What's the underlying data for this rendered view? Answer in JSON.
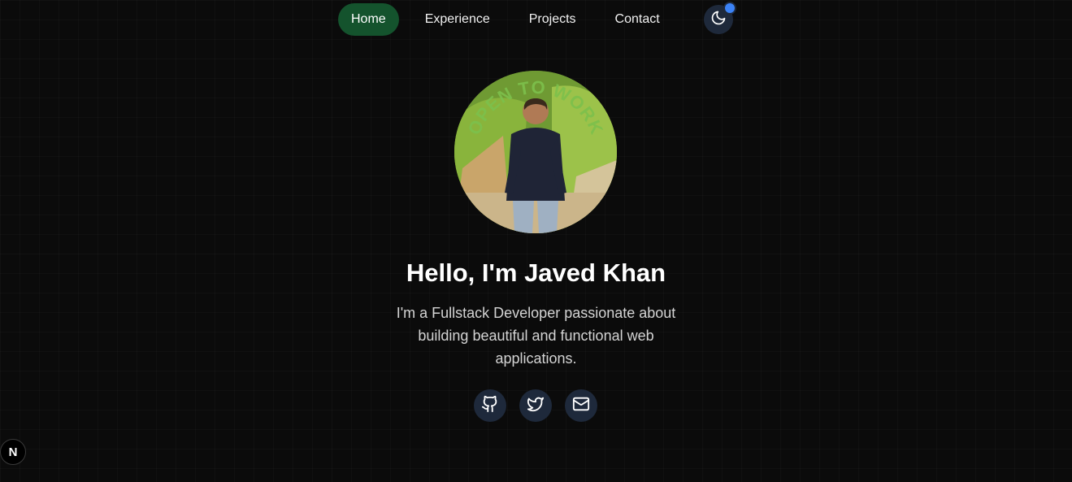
{
  "nav": {
    "items": [
      {
        "label": "Home",
        "active": true
      },
      {
        "label": "Experience",
        "active": false
      },
      {
        "label": "Projects",
        "active": false
      },
      {
        "label": "Contact",
        "active": false
      }
    ],
    "theme_icon": "moon-icon",
    "active_color": "#14532d"
  },
  "hero": {
    "avatar_badge_text": "OPEN TO WORK",
    "title": "Hello, I'm Javed Khan",
    "subtitle": "I'm a Fullstack Developer passionate about building beautiful and functional web applications."
  },
  "socials": [
    {
      "icon": "github-icon"
    },
    {
      "icon": "twitter-icon"
    },
    {
      "icon": "mail-icon"
    }
  ],
  "dev_badge": {
    "label": "N"
  },
  "colors": {
    "background": "#0b0b0b",
    "button_bg": "#1e293b",
    "notification_dot": "#3b82f6",
    "badge_text": "#7cc04b"
  }
}
